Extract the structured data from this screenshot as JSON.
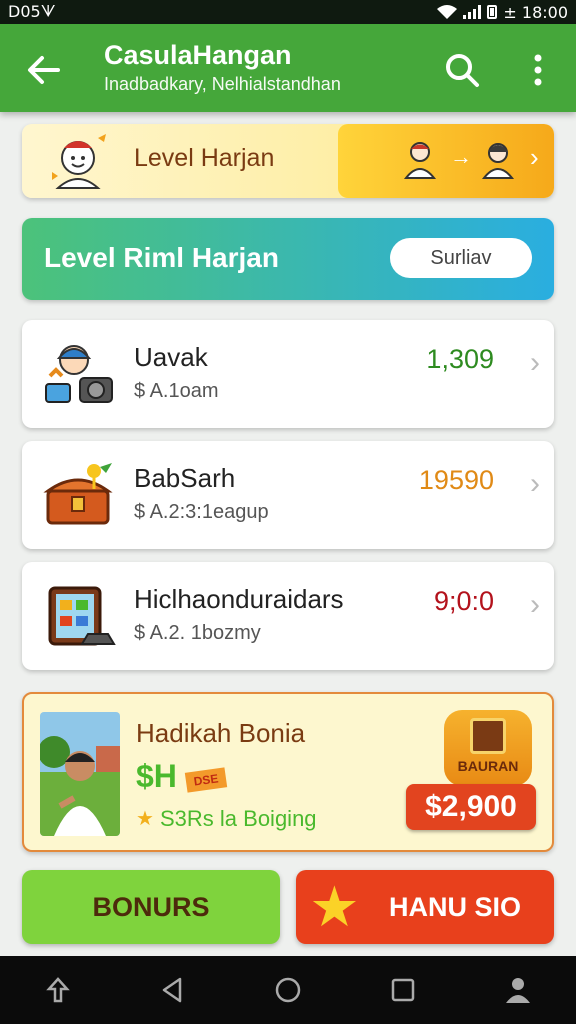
{
  "status_bar": {
    "left": "D05ᗐ",
    "time": "± 18:00"
  },
  "appbar": {
    "title": "CasulaHangan",
    "subtitle": "Inadbadkary, Nelhialstandhan",
    "icons": [
      "back-arrow-icon",
      "search-icon",
      "more-vert-icon"
    ]
  },
  "level_banner": {
    "label": "Level Harjan",
    "arrow": "→",
    "chevron": "›"
  },
  "level_banner2": {
    "label": "Level  Riml Harjan",
    "pill": "Surliav"
  },
  "items": [
    {
      "name": "Uavak",
      "sub": "$ A.1oam",
      "value": "1,309",
      "value_color": "#2e8b20"
    },
    {
      "name": "BabSarh",
      "sub": "$ A.2:3:1eagup",
      "value": "19590",
      "value_color": "#e08a16"
    },
    {
      "name": "Hiclhaonduraidars",
      "sub": "$ A.2. 1bozmy",
      "value": "9;0:0",
      "value_color": "#b3121c"
    }
  ],
  "bonus_card": {
    "title": "Hadikah Bonia",
    "amount": "$H",
    "tag": "DSE",
    "star": "★",
    "desc": "S3Rs la Boiging",
    "badge_label": "BAURAN",
    "price": "$2,900"
  },
  "buttons": {
    "left": "BONURS",
    "right": "HANU SIO",
    "right_star": "★"
  },
  "colors": {
    "appbar": "#45a73a",
    "accent_green": "#7fd33d",
    "accent_red": "#e8401c"
  }
}
